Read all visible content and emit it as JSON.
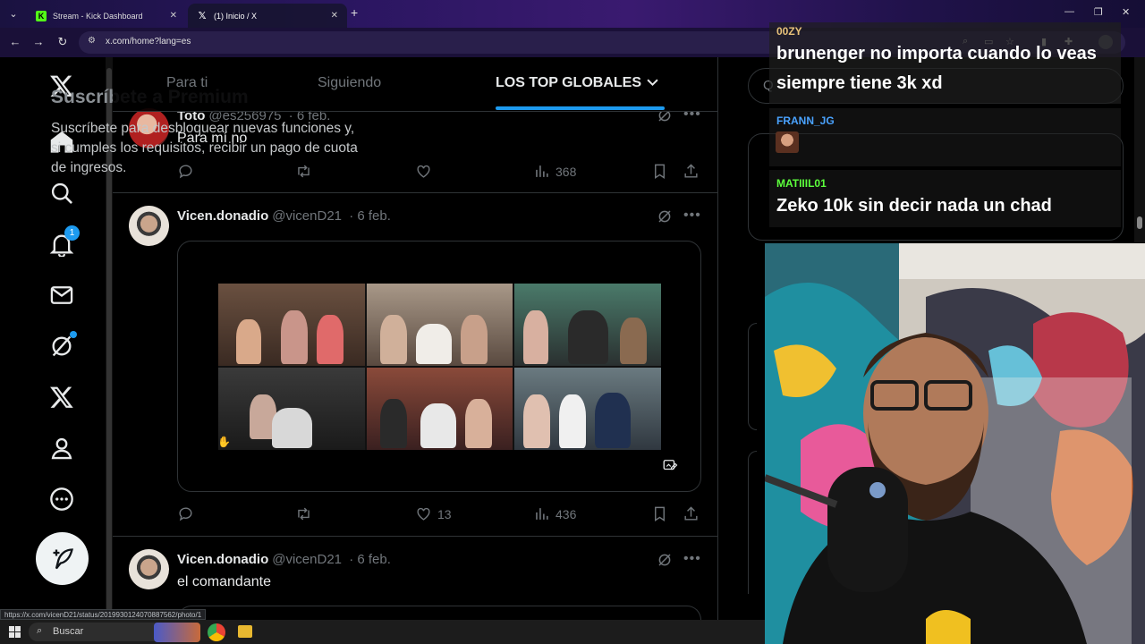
{
  "browser": {
    "tabs": [
      {
        "title": "Stream - Kick Dashboard",
        "favicon": "kick-icon"
      },
      {
        "title": "(1) Inicio / X",
        "favicon": "x-logo-icon"
      }
    ],
    "url": "x.com/home?lang=es",
    "status_url": "https://x.com/vicenD21/status/2019930124070887562/photo/1"
  },
  "header": {
    "tabs": [
      {
        "label": "Para ti",
        "active": false
      },
      {
        "label": "Siguiendo",
        "active": false
      },
      {
        "label": "LOS TOP GLOBALES",
        "active": true
      }
    ],
    "accent": "#1d9bf0"
  },
  "leftnav": {
    "icons": [
      "x-logo-icon",
      "home-icon",
      "search-icon",
      "notifications-icon",
      "messages-icon",
      "grok-icon",
      "premium-x-icon",
      "profile-icon",
      "more-icon"
    ],
    "notification_count": "1",
    "post_button_icon": "feather-plus-icon"
  },
  "tweets": [
    {
      "name": "Toto",
      "handle": "@es256975",
      "date": "· 6 feb.",
      "text": "Para mí no",
      "replies": "",
      "reposts": "",
      "likes": "",
      "views": "368"
    },
    {
      "name": "Vicen.donadio",
      "handle": "@vicenD21",
      "date": "· 6 feb.",
      "text": "",
      "replies": "",
      "reposts": "",
      "likes": "13",
      "views": "436"
    },
    {
      "name": "Vicen.donadio",
      "handle": "@vicenD21",
      "date": "· 6 feb.",
      "text": "el comandante"
    }
  ],
  "sidebar": {
    "search_placeholder": "Q",
    "premium_title": "Suscríbete a Premium",
    "premium_body": "Suscríbete para desbloquear nuevas funciones y, si cumples los requisitos, recibir un pago de cuota de ingresos."
  },
  "chat": [
    {
      "user": "00ZY",
      "user_color": "#e8c27a",
      "text": "brunenger no importa cuando lo veas siempre tiene 3k xd"
    },
    {
      "user": "FRANN_JG",
      "user_color": "#4aa3ff",
      "text": ""
    },
    {
      "user": "MATIIIL01",
      "user_color": "#5cff3c",
      "text": "Zeko 10k sin decir nada un chad"
    }
  ],
  "taskbar": {
    "search_label": "Buscar"
  }
}
